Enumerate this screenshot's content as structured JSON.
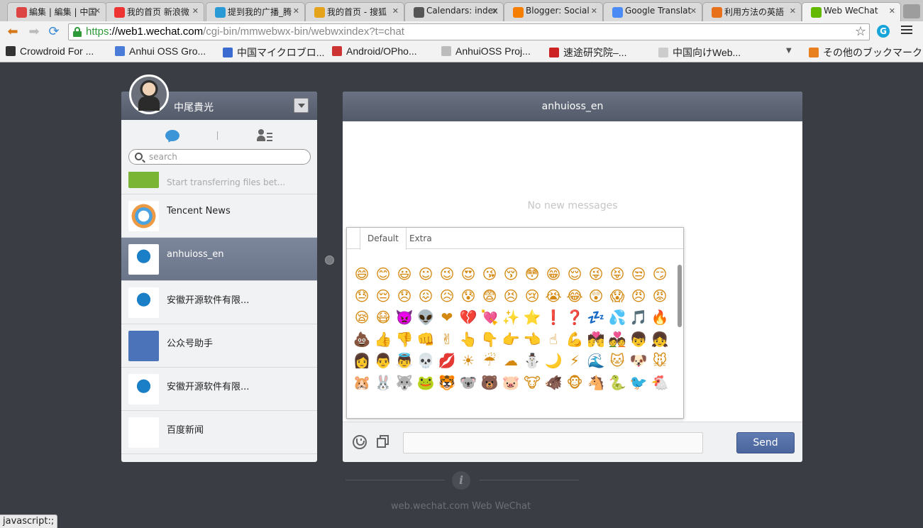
{
  "browser": {
    "tabs": [
      {
        "title": "編集 | 編集 | 中国",
        "icon": "tab-icon-blog",
        "color": "#d44"
      },
      {
        "title": "我的首页 新浪微",
        "icon": "tab-icon-weibo",
        "color": "#e33"
      },
      {
        "title": "提到我的广播_腾",
        "icon": "tab-icon-tencent",
        "color": "#2a9ad6"
      },
      {
        "title": "我的首页 - 搜狐",
        "icon": "tab-icon-sohu",
        "color": "#e5a21b"
      },
      {
        "title": "Calendars: index",
        "icon": "tab-icon-calendar",
        "color": "#555"
      },
      {
        "title": "Blogger: Social",
        "icon": "tab-icon-blogger",
        "color": "#f57d00"
      },
      {
        "title": "Google Translat",
        "icon": "tab-icon-translate",
        "color": "#4a8af4"
      },
      {
        "title": "利用方法の英語",
        "icon": "tab-icon-weblio",
        "color": "#e8701a"
      },
      {
        "title": "Web WeChat",
        "icon": "tab-icon-wechat",
        "color": "#62b900"
      }
    ],
    "url_scheme": "https",
    "url_host": "://web1.wechat.com",
    "url_path": "/cgi-bin/mmwebwx-bin/webwxindex?t=chat",
    "bookmarks": [
      {
        "label": "Crowdroid For ...",
        "color": "#333"
      },
      {
        "label": "Anhui OSS Gro...",
        "color": "#4a7bd6"
      },
      {
        "label": "中国マイクロブロ...",
        "color": "#3b6bd1"
      },
      {
        "label": "Android/OPho...",
        "color": "#c33"
      },
      {
        "label": "AnhuiOSS Proj...",
        "color": "#bbb"
      },
      {
        "label": "速途研究院–...",
        "color": "#c22"
      },
      {
        "label": "中国向けWeb...",
        "color": "#ccc"
      }
    ],
    "other_bookmarks": "その他のブックマーク",
    "status": "javascript:;"
  },
  "wechat": {
    "user_name": "中尾貴光",
    "search_placeholder": "search",
    "conversations": [
      {
        "name": "",
        "preview": "Start transferring files bet...",
        "avatar": "file-transfer",
        "active": false
      },
      {
        "name": "Tencent News",
        "preview": "",
        "avatar": "tencent-news",
        "active": false
      },
      {
        "name": "anhuioss_en",
        "preview": "",
        "avatar": "anhui-oss",
        "active": true
      },
      {
        "name": "安徽开源软件有限...",
        "preview": "",
        "avatar": "anhui-oss",
        "active": false
      },
      {
        "name": "公众号助手",
        "preview": "",
        "avatar": "official-assistant",
        "active": false
      },
      {
        "name": "安徽开源软件有限...",
        "preview": "",
        "avatar": "anhui-oss",
        "active": false
      },
      {
        "name": "百度新闻",
        "preview": "",
        "avatar": "baidu-news",
        "active": false
      }
    ],
    "chat_title": "anhuioss_en",
    "no_messages": "No new messages",
    "emoji_tabs": [
      "Default",
      "Extra"
    ],
    "send_label": "Send",
    "footer": "web.wechat.com  Web WeChat"
  },
  "emoji": [
    "😄",
    "😊",
    "😃",
    "☺",
    "😉",
    "😍",
    "😘",
    "😚",
    "😳",
    "😁",
    "😌",
    "😜",
    "😝",
    "😒",
    "😏",
    "😓",
    "😔",
    "😞",
    "😖",
    "😥",
    "😰",
    "😨",
    "😣",
    "😢",
    "😭",
    "😂",
    "😲",
    "😱",
    "😠",
    "😡",
    "😪",
    "😷",
    "👿",
    "👽",
    "❤",
    "💔",
    "💘",
    "✨",
    "⭐",
    "❗",
    "❓",
    "💤",
    "💦",
    "🎵",
    "🔥",
    "💩",
    "👍",
    "👎",
    "👊",
    "✌",
    "👆",
    "👇",
    "👉",
    "👈",
    "☝",
    "💪",
    "💏",
    "💑",
    "👦",
    "👧",
    "👩",
    "👨",
    "👼",
    "💀",
    "💋",
    "☀",
    "☔",
    "☁",
    "⛄",
    "🌙",
    "⚡",
    "🌊",
    "🐱",
    "🐶",
    "🐭",
    "🐹",
    "🐰",
    "🐺",
    "🐸",
    "🐯",
    "🐨",
    "🐻",
    "🐷",
    "🐮",
    "🐗",
    "🐵",
    "🐴",
    "🐍",
    "🐦",
    "🐔"
  ]
}
